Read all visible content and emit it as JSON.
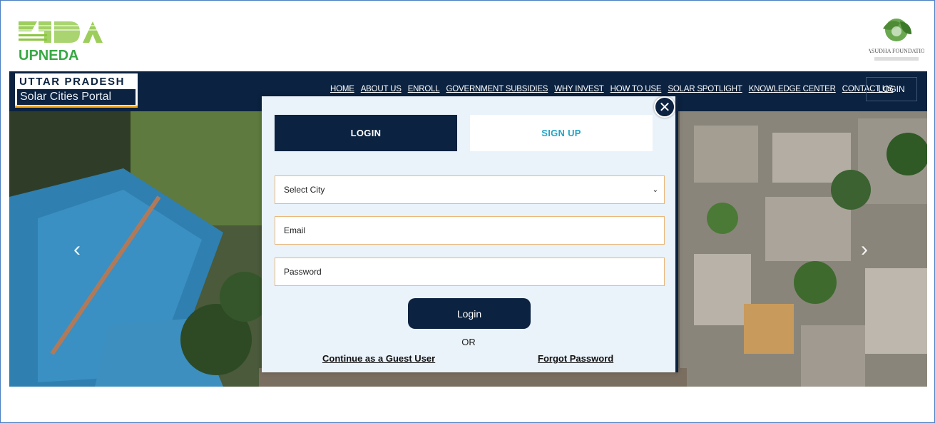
{
  "header": {
    "left_logo_text": "UPNEDA",
    "right_logo_text": "VASUDHA FOUNDATION"
  },
  "brand": {
    "line1": "UTTAR PRADESH",
    "line2": "Solar Cities Portal"
  },
  "nav": {
    "links": [
      "HOME",
      "ABOUT US",
      "ENROLL",
      "GOVERNMENT SUBSIDIES",
      "WHY INVEST",
      "HOW TO USE",
      "SOLAR SPOTLIGHT",
      "KNOWLEDGE CENTER",
      "CONTACT US"
    ],
    "login_label": "LOGIN"
  },
  "carousel": {
    "prev_icon": "chevron-left-icon",
    "next_icon": "chevron-right-icon"
  },
  "modal": {
    "close_icon": "close-icon",
    "tab_login": "LOGIN",
    "tab_signup": "SIGN UP",
    "city_select": {
      "selected": "Select City"
    },
    "email_placeholder": "Email",
    "password_placeholder": "Password",
    "login_button": "Login",
    "or_text": "OR",
    "guest_link": "Continue as a Guest User",
    "forgot_link": "Forgot Password"
  },
  "colors": {
    "navy": "#0b2240",
    "accent_orange": "#f2a61c",
    "signup_teal": "#1fa6c8",
    "modal_bg": "#eaf2fa"
  }
}
